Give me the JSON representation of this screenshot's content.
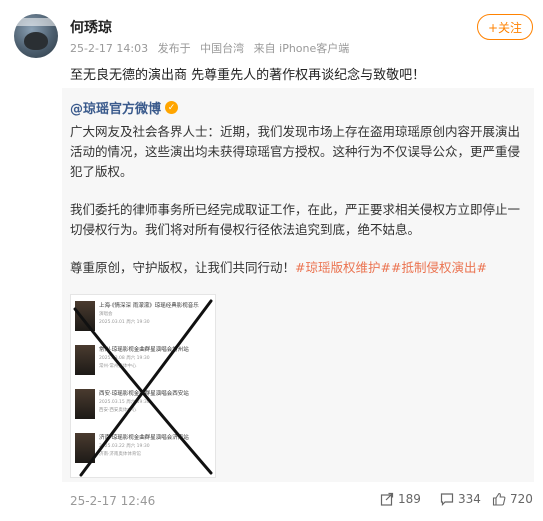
{
  "post": {
    "username": "何琇琼",
    "time": "25-2-17 14:03",
    "from_label": "发布于",
    "location": "中国台湾",
    "device": "来自 iPhone客户端",
    "follow_label": "+关注",
    "text": "至无良无德的演出商 先尊重先人的著作权再谈纪念与致敬吧！"
  },
  "repost": {
    "author": "@琼瑶官方微博",
    "para1": "广大网友及社会各界人士：近期，我们发现市场上存在盗用琼瑶原创内容开展演出活动的情况，这些演出均未获得琼瑶官方授权。这种行为不仅误导公众，更严重侵犯了版权。",
    "para2": "我们委托的律师事务所已经完成取证工作，在此，严正要求相关侵权方立即停止一切侵权行为。我们将对所有侵权行径依法追究到底，绝不姑息。",
    "para3_text": "尊重原创，守护版权，让我们共同行动！",
    "hashtag1": "#琼瑶版权维护#",
    "hashtag2": "#抵制侵权演出#",
    "image_rows": [
      {
        "title": "上海·《情深深 雨濛濛》琼瑶经典影视音乐",
        "sub": "演唱会",
        "date": "2025.03.01 周六 19:30"
      },
      {
        "title": "常州·琼瑶影视金曲群星演唱会常州站",
        "sub": "2025.03.08 周六 19:30",
        "date": "常州·常州奥体中心"
      },
      {
        "title": "西安·琼瑶影视金曲群星演唱会西安站",
        "sub": "2025.03.15 周六 19:30",
        "date": "西安·西安奥体中心"
      },
      {
        "title": "济南·琼瑶影视金曲群星演唱会济南站",
        "sub": "2025.03.22 周六 19:30",
        "date": "济南·济南奥体体育馆"
      }
    ]
  },
  "footer": {
    "time": "25-2-17 12:46",
    "share_count": "189",
    "comment_count": "334",
    "like_count": "720"
  },
  "colors": {
    "accent": "#ff8200",
    "link": "#3a5a8c",
    "hashtag": "#eb7350"
  }
}
